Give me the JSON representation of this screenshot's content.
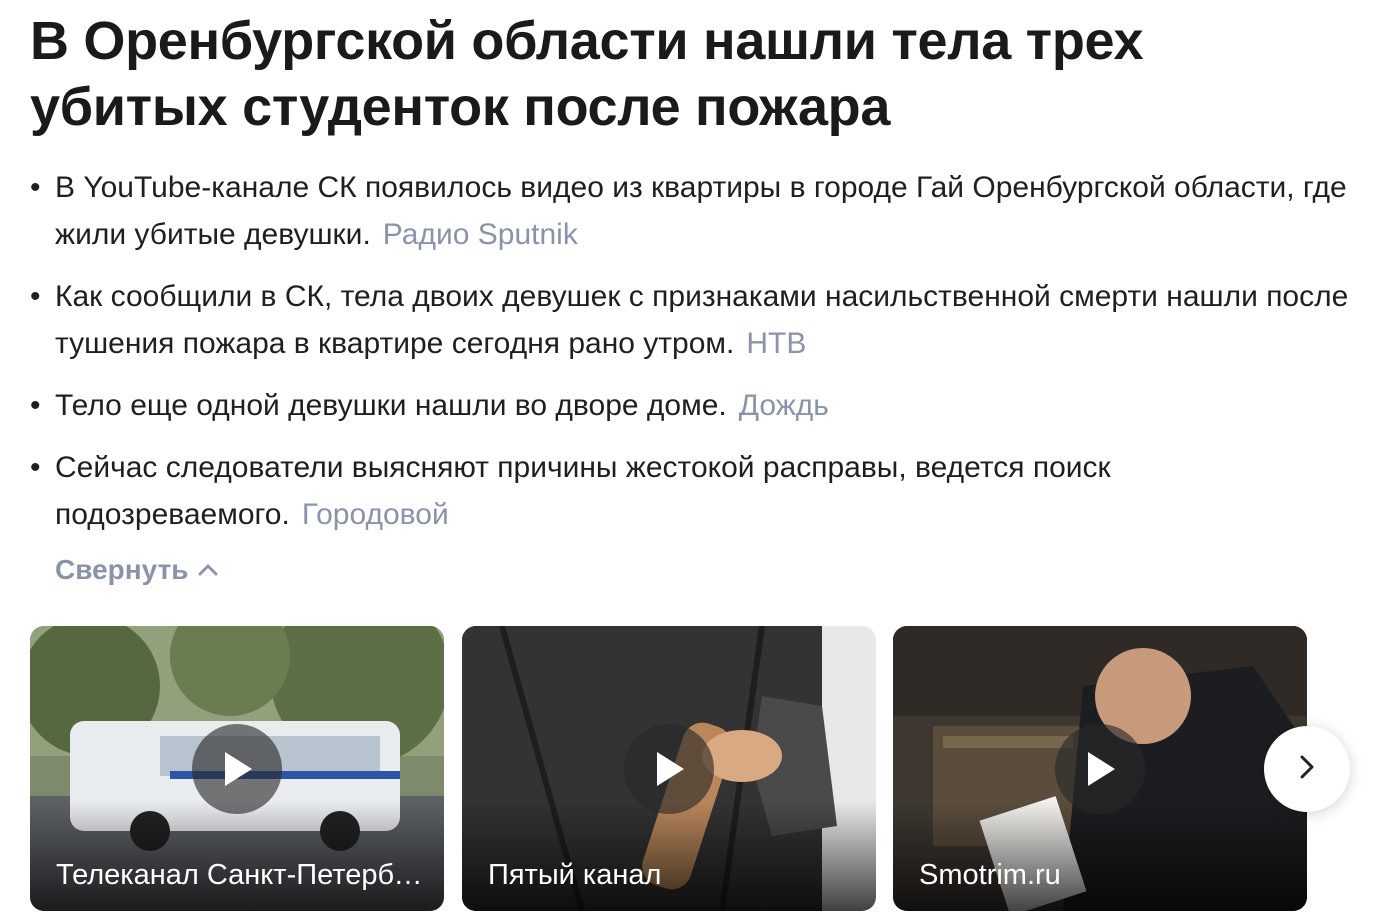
{
  "headline": "В Оренбургской области нашли тела трех убитых студенток после пожара",
  "bullets": [
    {
      "text": "В YouTube-канале СК появилось видео из квартиры в городе Гай Оренбургской области, где жили убитые девушки.",
      "source": "Радио Sputnik"
    },
    {
      "text": "Как сообщили в СК, тела двоих девушек с признаками насильственной смерти нашли после тушения пожара в квартире сегодня рано утром.",
      "source": "НТВ"
    },
    {
      "text": "Тело еще одной девушки нашли во дворе доме.",
      "source": "Дождь"
    },
    {
      "text": "Сейчас следователи выясняют причины жестокой расправы, ведется поиск подозреваемого.",
      "source": "Городовой"
    }
  ],
  "collapse_label": "Свернуть",
  "videos": [
    {
      "source": "Телеканал Санкт-Петербург",
      "icon": "play-icon"
    },
    {
      "source": "Пятый канал",
      "icon": "play-icon"
    },
    {
      "source": "Smotrim.ru",
      "icon": "play-icon"
    }
  ],
  "icons": {
    "collapse": "chevron-up-icon",
    "next": "chevron-right-icon",
    "play": "play-icon"
  },
  "colors": {
    "headline": "#1a1a1a",
    "text": "#1f1f1f",
    "source": "#8b93a8"
  }
}
